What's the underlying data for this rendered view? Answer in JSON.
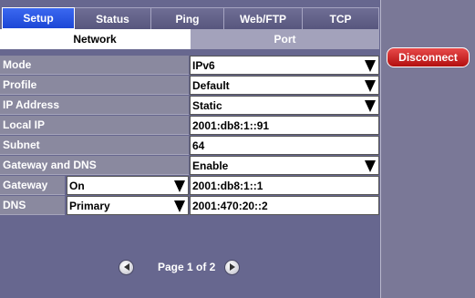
{
  "tabs": [
    {
      "label": "Setup"
    },
    {
      "label": "Status"
    },
    {
      "label": "Ping"
    },
    {
      "label": "Web/FTP"
    },
    {
      "label": "TCP"
    }
  ],
  "subtabs": [
    {
      "label": "Network"
    },
    {
      "label": "Port"
    }
  ],
  "form": {
    "mode": {
      "label": "Mode",
      "value": "IPv6"
    },
    "profile": {
      "label": "Profile",
      "value": "Default"
    },
    "ip_address": {
      "label": "IP Address",
      "value": "Static"
    },
    "local_ip": {
      "label": "Local IP",
      "value": "2001:db8:1::91"
    },
    "subnet": {
      "label": "Subnet",
      "value": "64"
    },
    "gateway_dns": {
      "label": "Gateway and DNS",
      "value": "Enable"
    },
    "gateway": {
      "label": "Gateway",
      "mode": "On",
      "value": "2001:db8:1::1"
    },
    "dns": {
      "label": "DNS",
      "mode": "Primary",
      "value": "2001:470:20::2"
    }
  },
  "pager": {
    "text": "Page 1 of 2"
  },
  "actions": {
    "disconnect": "Disconnect"
  }
}
